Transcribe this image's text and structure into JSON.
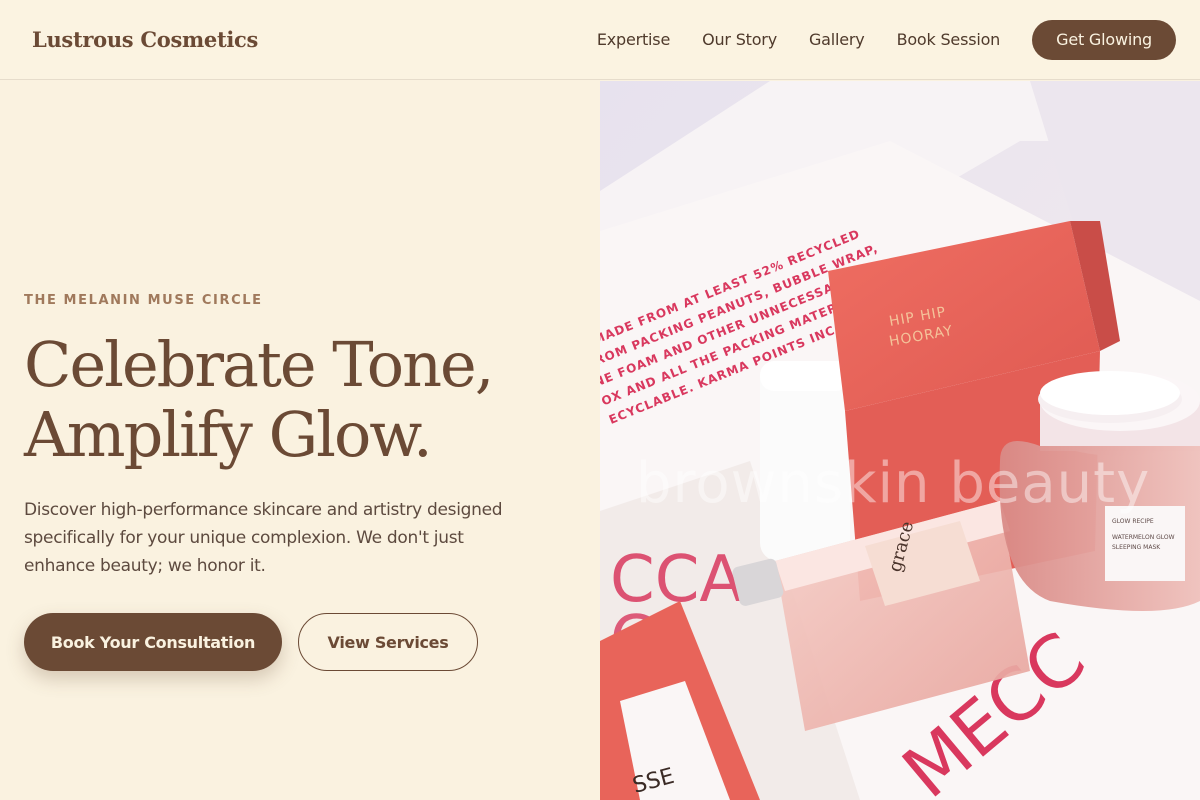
{
  "brand": {
    "name": "Lustrous Cosmetics"
  },
  "nav": {
    "links": [
      "Expertise",
      "Our Story",
      "Gallery",
      "Book Session"
    ],
    "cta": "Get Glowing"
  },
  "hero": {
    "eyebrow": "THE MELANIN MUSE CIRCLE",
    "headline_line1": "Celebrate Tone,",
    "headline_line2": "Amplify Glow.",
    "description": "Discover high-performance skincare and artistry designed specifically for your unique complexion. We don't just enhance beauty; we honor it.",
    "primary_button": "Book Your Consultation",
    "secondary_button": "View Services"
  },
  "image": {
    "watermark": "brownskin beauty",
    "box_text": "S MADE FROM AT LEAST 52% RECYCLED FROM PACKING PEANUTS, BUBBLE WRAP, NE FOAM AND OTHER UNNECESSARY FILLS OX AND ALL THE PACKING MATERIALS ECYCLABLE. KARMA POINTS INC",
    "cube_label": "HIP HIP HOORAY",
    "jar_label": "GLOW RECIPE WATERMELON GLOW SLEEPING MASK",
    "bottle_label": "grace",
    "box_brand": "MECCA",
    "colors": {
      "box_pink": "#d9385e",
      "coral": "#e8645a"
    }
  },
  "colors": {
    "background": "#faf2e0",
    "accent": "#6b4a35"
  }
}
